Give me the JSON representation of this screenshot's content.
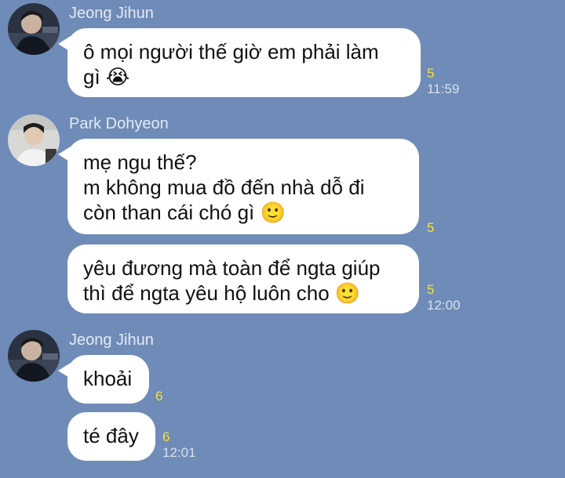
{
  "messages": [
    {
      "sender": "Jeong Jihun",
      "lines": [
        "ô mọi người thế giờ em phải làm",
        "gì 😭"
      ],
      "count": "5",
      "time": "11:59"
    },
    {
      "sender": "Park Dohyeon",
      "lines": [
        "mẹ ngu thế?",
        "m không mua đồ đến nhà dỗ đi",
        "còn than cái chó gì 🙂"
      ],
      "count": "5",
      "time": ""
    },
    {
      "sender": "",
      "lines": [
        "yêu đương mà toàn để ngta giúp",
        "thì để ngta yêu hộ luôn cho 🙂"
      ],
      "count": "5",
      "time": "12:00"
    },
    {
      "sender": "Jeong Jihun",
      "lines": [
        "khoải"
      ],
      "count": "6",
      "time": ""
    },
    {
      "sender": "",
      "lines": [
        "té đây"
      ],
      "count": "6",
      "time": "12:01"
    }
  ],
  "icons": {
    "avatar_jihun": "user-avatar-dark",
    "avatar_dohyeon": "user-avatar-light"
  },
  "colors": {
    "background": "#6f8bb8",
    "bubble": "#ffffff",
    "read_count": "#f3e23a"
  }
}
